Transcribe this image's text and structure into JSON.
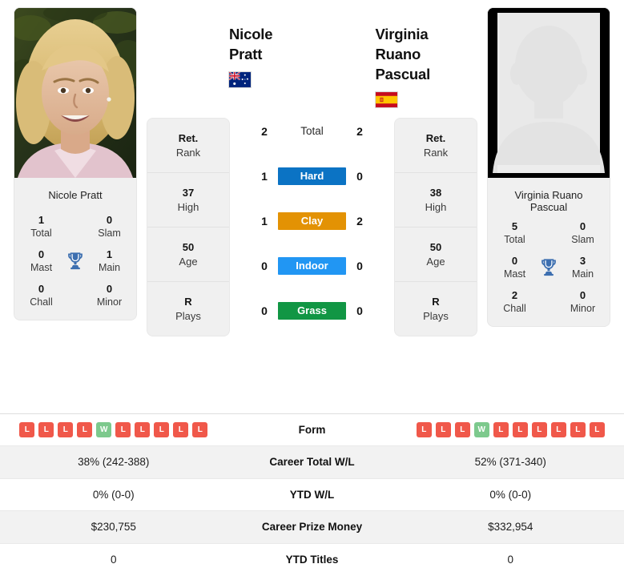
{
  "players": {
    "left": {
      "name": "Nicole Pratt",
      "country": "australia",
      "photo": "photo-nicole-pratt",
      "titles": {
        "caption": "Nicole Pratt",
        "total": "1",
        "total_label": "Total",
        "slam": "0",
        "slam_label": "Slam",
        "mast": "0",
        "mast_label": "Mast",
        "main": "1",
        "main_label": "Main",
        "chall": "0",
        "chall_label": "Chall",
        "minor": "0",
        "minor_label": "Minor",
        "icon": "trophy-icon"
      },
      "info": [
        {
          "value": "Ret.",
          "label": "Rank"
        },
        {
          "value": "37",
          "label": "High"
        },
        {
          "value": "50",
          "label": "Age"
        },
        {
          "value": "R",
          "label": "Plays"
        }
      ],
      "form": [
        "L",
        "L",
        "L",
        "L",
        "W",
        "L",
        "L",
        "L",
        "L",
        "L"
      ],
      "career_wl": "38% (242-388)",
      "ytd_wl": "0% (0-0)",
      "prize_money": "$230,755",
      "ytd_titles": "0"
    },
    "right": {
      "name": "Virginia Ruano Pascual",
      "country": "spain",
      "photo": "photo-placeholder-silhouette",
      "titles": {
        "caption": "Virginia Ruano Pascual",
        "total": "5",
        "total_label": "Total",
        "slam": "0",
        "slam_label": "Slam",
        "mast": "0",
        "mast_label": "Mast",
        "main": "3",
        "main_label": "Main",
        "chall": "2",
        "chall_label": "Chall",
        "minor": "0",
        "minor_label": "Minor",
        "icon": "trophy-icon"
      },
      "info": [
        {
          "value": "Ret.",
          "label": "Rank"
        },
        {
          "value": "38",
          "label": "High"
        },
        {
          "value": "50",
          "label": "Age"
        },
        {
          "value": "R",
          "label": "Plays"
        }
      ],
      "form": [
        "L",
        "L",
        "L",
        "W",
        "L",
        "L",
        "L",
        "L",
        "L",
        "L"
      ],
      "career_wl": "52% (371-340)",
      "ytd_wl": "0% (0-0)",
      "prize_money": "$332,954",
      "ytd_titles": "0"
    }
  },
  "head_to_head": [
    {
      "surface": "Total",
      "left": "2",
      "right": "2",
      "color": "none",
      "style": "plain"
    },
    {
      "surface": "Hard",
      "left": "1",
      "right": "0",
      "color": "#0b73c4",
      "style": "badge"
    },
    {
      "surface": "Clay",
      "left": "1",
      "right": "2",
      "color": "#e39204",
      "style": "badge"
    },
    {
      "surface": "Indoor",
      "left": "0",
      "right": "0",
      "color": "#2196f3",
      "style": "badge"
    },
    {
      "surface": "Grass",
      "left": "0",
      "right": "0",
      "color": "#119644",
      "style": "badge"
    }
  ],
  "stats_rows": [
    {
      "label": "Form",
      "type": "form",
      "shade": false
    },
    {
      "label": "Career Total W/L",
      "type": "text",
      "shade": true,
      "key": "career_wl"
    },
    {
      "label": "YTD W/L",
      "type": "text",
      "shade": false,
      "key": "ytd_wl"
    },
    {
      "label": "Career Prize Money",
      "type": "text",
      "shade": true,
      "key": "prize_money"
    },
    {
      "label": "YTD Titles",
      "type": "text",
      "shade": false,
      "key": "ytd_titles"
    }
  ],
  "colors": {
    "win": "#7dc98d",
    "loss": "#f0584a",
    "card": "#f0f0f0",
    "trophy": "#3d6fb0"
  }
}
